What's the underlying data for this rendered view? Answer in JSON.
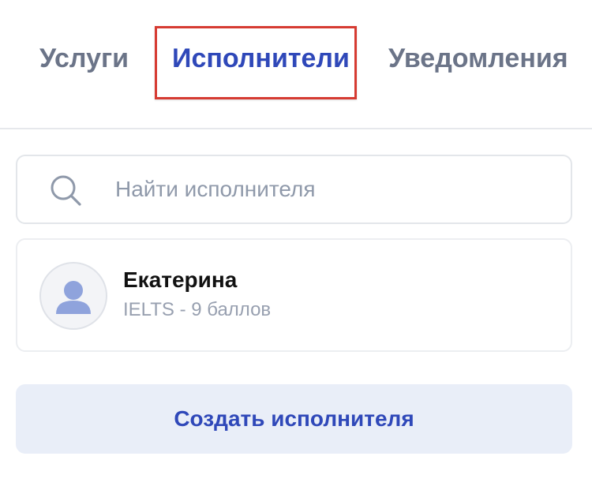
{
  "tabs": [
    {
      "label": "Услуги",
      "active": false
    },
    {
      "label": "Исполнители",
      "active": true
    },
    {
      "label": "Уведомления",
      "active": false
    }
  ],
  "search": {
    "placeholder": "Найти исполнителя",
    "value": "",
    "icon": "search-icon"
  },
  "performers": [
    {
      "name": "Екатерина",
      "subtitle": "IELTS - 9 баллов",
      "avatar_icon": "user-icon"
    }
  ],
  "actions": {
    "create_label": "Создать исполнителя"
  },
  "colors": {
    "accent": "#2f48b9",
    "tab_inactive": "#6b7488",
    "highlight_border": "#d63b32",
    "button_bg": "#e9eef8",
    "avatar_figure": "#8fa3dc"
  }
}
